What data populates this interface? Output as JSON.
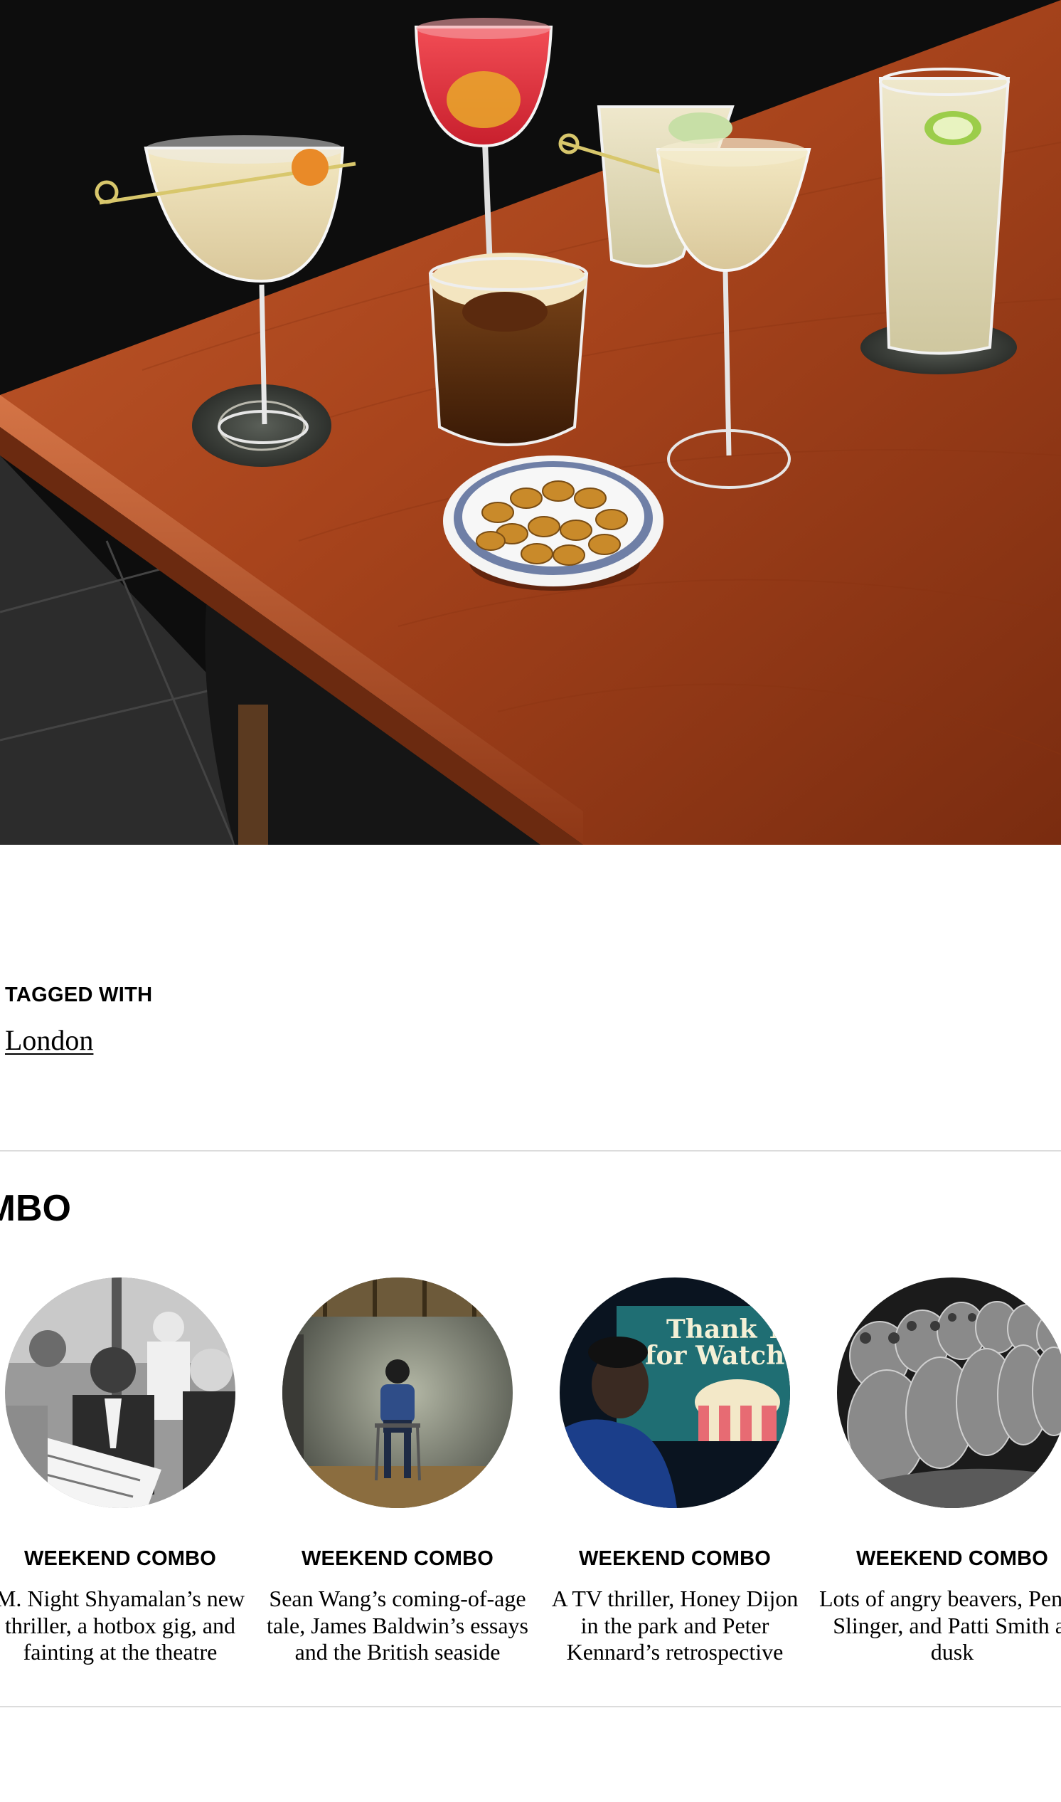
{
  "hero": {
    "image_icon": "cocktails-on-wooden-table-photo"
  },
  "tags": {
    "heading": "TAGGED WITH",
    "items": [
      {
        "label": "London"
      }
    ]
  },
  "section": {
    "title": "WEEKEND COMBO"
  },
  "carousel": {
    "cards": [
      {
        "kicker": "WEEKEND COMBO",
        "headline": "M. Night Shyamalan’s new thriller, a hotbox gig, and fainting at the theatre",
        "image_icon": "man-reading-newspaper-photo"
      },
      {
        "kicker": "WEEKEND COMBO",
        "headline": "Sean Wang’s coming-of-age tale, James Baldwin’s essays and the British seaside",
        "image_icon": "boy-seated-on-chair-photo"
      },
      {
        "kicker": "WEEKEND COMBO",
        "headline": "A TV thriller, Honey Dijon in the park and Peter Kennard’s retrospective",
        "image_icon": "man-before-thank-you-screen-photo",
        "screen_text_line1": "Thank Y",
        "screen_text_line2": "for Watch"
      },
      {
        "kicker": "WEEKEND COMBO",
        "headline": "Lots of angry beavers, Penny Slinger, and Patti Smith at dusk",
        "image_icon": "beaver-figures-photo"
      }
    ]
  },
  "colors": {
    "table_wood": "#a8441c",
    "background": "#ffffff",
    "divider": "#dcdcdc"
  }
}
